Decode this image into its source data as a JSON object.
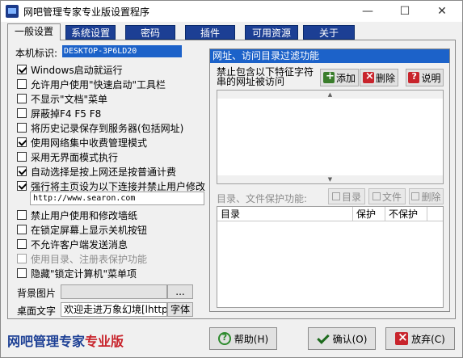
{
  "window": {
    "title": "网吧管理专家专业版设置程序",
    "minimize": "—",
    "maximize": "☐",
    "close": "✕"
  },
  "tabs": [
    "一般设置",
    "系统设置",
    "密码",
    "插件",
    "可用资源",
    "关于"
  ],
  "general": {
    "machine_label": "本机标识:",
    "machine_id": "DESKTOP-3P6LD20",
    "options": [
      {
        "label": "Windows启动就运行",
        "checked": true,
        "disabled": false
      },
      {
        "label": "允许用户使用\"快速启动\"工具栏",
        "checked": false,
        "disabled": false
      },
      {
        "label": "不显示\"文档\"菜单",
        "checked": false,
        "disabled": false
      },
      {
        "label": "屏蔽掉F4 F5 F8",
        "checked": false,
        "disabled": false
      },
      {
        "label": "将历史记录保存到服务器(包括网址)",
        "checked": false,
        "disabled": false
      },
      {
        "label": "使用网络集中收费管理模式",
        "checked": true,
        "disabled": false
      },
      {
        "label": "采用无界面模式执行",
        "checked": false,
        "disabled": false
      },
      {
        "label": "自动选择是按上网还是按普通计费",
        "checked": true,
        "disabled": false
      },
      {
        "label": "强行将主页设为以下连接并禁止用户修改",
        "checked": true,
        "disabled": false
      }
    ],
    "homepage_url": "http://www.searon.com",
    "options2": [
      {
        "label": "禁止用户使用和修改墙纸",
        "checked": false,
        "disabled": false
      },
      {
        "label": "在锁定屏幕上显示关机按钮",
        "checked": false,
        "disabled": false
      },
      {
        "label": "不允许客户端发送消息",
        "checked": false,
        "disabled": false
      },
      {
        "label": "使用目录、注册表保护功能",
        "checked": false,
        "disabled": true
      },
      {
        "label": "隐藏\"锁定计算机\"菜单项",
        "checked": false,
        "disabled": false
      }
    ],
    "bg_label": "背景图片",
    "bg_value": "",
    "browse_label": "...",
    "desktop_text_label": "桌面文字",
    "desktop_text_value": "欢迎走进万象幻境[lhttp://",
    "font_button": "字体"
  },
  "filter": {
    "title": "网址、访问目录过滤功能",
    "label": "禁止包含以下特征字符串的网址被访问",
    "add": "添加",
    "delete": "删除",
    "help": "说明",
    "scroll_up": "▲",
    "scroll_down": "▼"
  },
  "protect": {
    "label": "目录、文件保护功能:",
    "dir_btn": "目录",
    "file_btn": "文件",
    "del_btn": "删除",
    "columns": [
      "目录",
      "保护",
      "不保护"
    ]
  },
  "footer": {
    "brand_part1": "网吧管理专家",
    "brand_part2": "专业版",
    "help": "帮助(H)",
    "ok": "确认(O)",
    "cancel": "放弃(C)"
  },
  "colors": {
    "tab_blue": "#1c3f94",
    "selection_blue": "#1c62c9",
    "brand_red": "#c8242c"
  }
}
